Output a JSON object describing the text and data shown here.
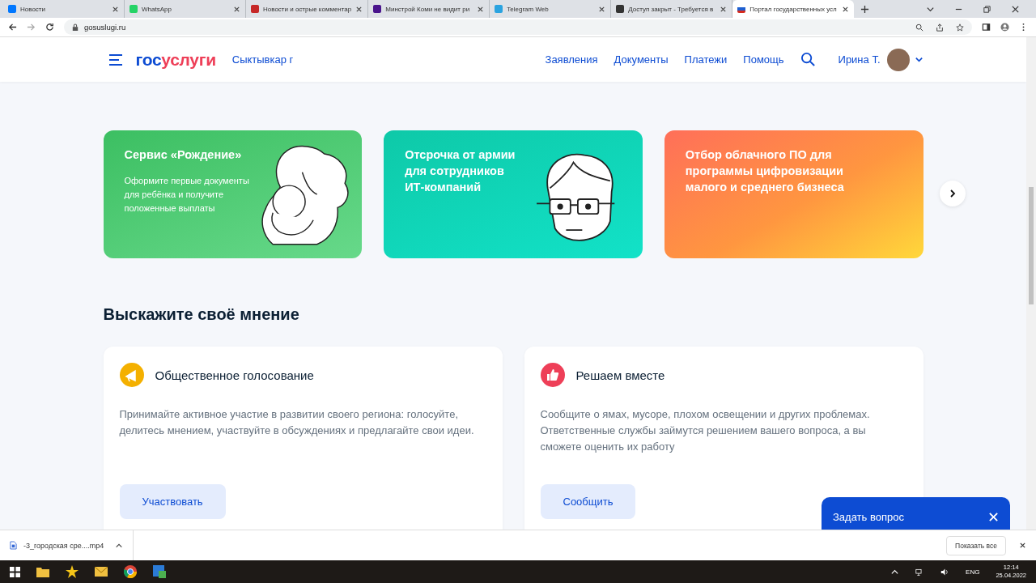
{
  "browser": {
    "tabs": [
      {
        "title": "Новости",
        "selected": false
      },
      {
        "title": "WhatsApp",
        "selected": false
      },
      {
        "title": "Новости и острые комментар",
        "selected": false
      },
      {
        "title": "Минстрой Коми не видит ри",
        "selected": false
      },
      {
        "title": "Telegram Web",
        "selected": false
      },
      {
        "title": "Доступ закрыт - Требуется в",
        "selected": false
      },
      {
        "title": "Портал государственных усл",
        "selected": true
      }
    ],
    "address": "gosuslugi.ru"
  },
  "header": {
    "logo_part_1": "гос",
    "logo_part_2": "услуги",
    "city": "Сыктывкар г",
    "nav": [
      "Заявления",
      "Документы",
      "Платежи",
      "Помощь"
    ],
    "user": "Ирина Т."
  },
  "banners": [
    {
      "kind": "birth",
      "title": "Сервис «Рождение»",
      "text": "Оформите первые документы для ребёнка и получите положенные выплаты"
    },
    {
      "kind": "army",
      "title": "Отсрочка от армии для сотрудников ИТ‑компаний"
    },
    {
      "kind": "cloud",
      "title": "Отбор облачного ПО для программы цифровизации малого и среднего бизнеса"
    }
  ],
  "opinion": {
    "heading": "Выскажите своё мнение",
    "cards": [
      {
        "kind": "vote",
        "title": "Общественное голосование",
        "text": "Принимайте активное участие в развитии своего региона: голосуйте, делитесь мнением, участвуйте в обсуждениях и предлагайте свои идеи.",
        "button": "Участвовать"
      },
      {
        "kind": "solve",
        "title": "Решаем вместе",
        "text": "Сообщите о ямах, мусоре, плохом освещении и других проблемах. Ответственные службы займутся решением вашего вопроса, а вы сможете оценить их работу",
        "button": "Сообщить"
      }
    ]
  },
  "chat": {
    "label": "Задать вопрос"
  },
  "downloads": {
    "file": "-3_городская сре....mp4",
    "show_all": "Показать все"
  },
  "taskbar": {
    "language": "ENG",
    "time": "12:14",
    "date": "25.04.2022"
  }
}
